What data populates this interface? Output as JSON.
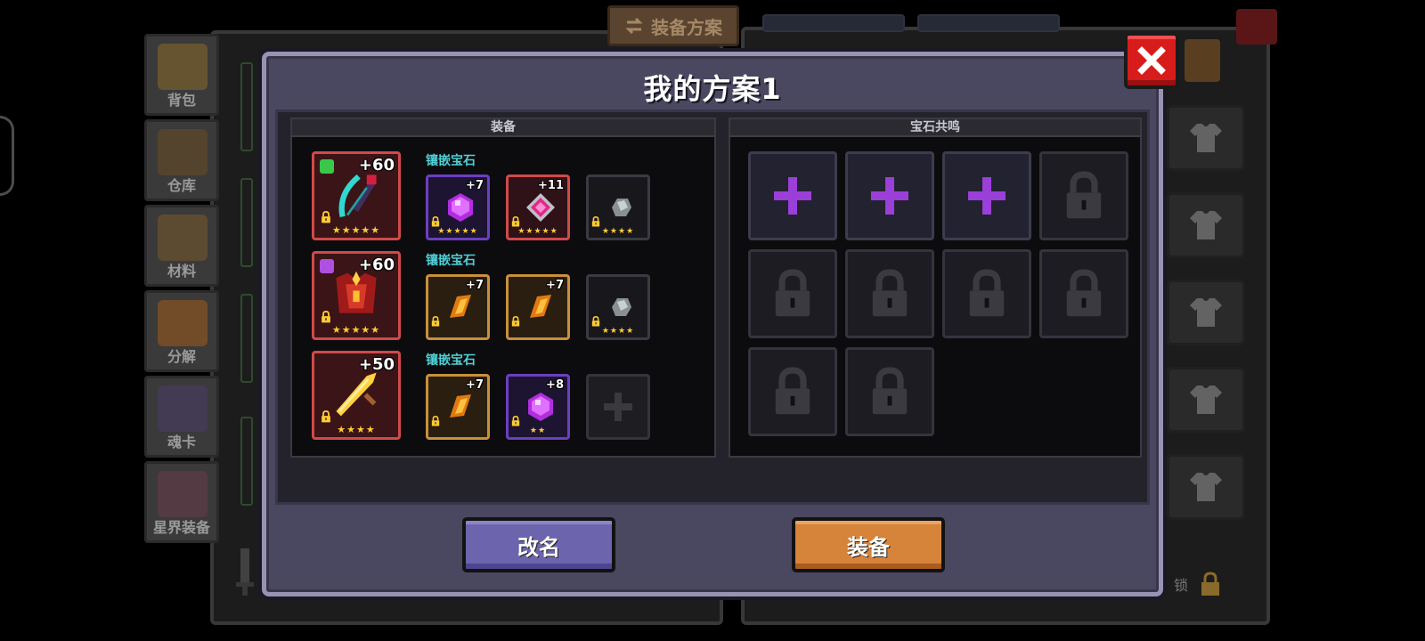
{
  "background": {
    "nav_items": [
      {
        "label": "背包",
        "icon": "backpack-icon",
        "color": "#8a6a2a"
      },
      {
        "label": "仓库",
        "icon": "warehouse-chest-icon",
        "color": "#6a4a22"
      },
      {
        "label": "材料",
        "icon": "materials-book-icon",
        "color": "#7a5a2a"
      },
      {
        "label": "分解",
        "icon": "decompose-furnace-icon",
        "color": "#a05a1a"
      },
      {
        "label": "魂卡",
        "icon": "soul-card-icon",
        "color": "#4a3a6a"
      },
      {
        "label": "星界装备",
        "icon": "astral-gear-icon",
        "color": "#6a3a4a"
      }
    ],
    "plan_tab_label": "装备方案",
    "lock_text": "锁"
  },
  "modal": {
    "title": "我的方案1",
    "equipment_header": "装备",
    "resonance_header": "宝石共鸣",
    "inlay_label": "镶嵌宝石",
    "equipment": [
      {
        "name": "weapon-bow",
        "level": "+60",
        "stars": "★★★★★",
        "frame": "#d04a4a",
        "badge": "green-gem",
        "sockets": [
          {
            "type": "purple",
            "gem": "amethyst",
            "level": "+7",
            "stars": "★★★★★"
          },
          {
            "type": "red",
            "gem": "ruby-crest",
            "level": "+11",
            "stars": "★★★★★"
          },
          {
            "type": "grey",
            "gem": "stone",
            "level": "",
            "stars": "★★★★"
          }
        ]
      },
      {
        "name": "armor-crimson",
        "level": "+60",
        "stars": "★★★★★",
        "frame": "#d04a4a",
        "badge": "purple-sparkle",
        "sockets": [
          {
            "type": "gold",
            "gem": "amber",
            "level": "+7",
            "stars": ""
          },
          {
            "type": "gold",
            "gem": "amber",
            "level": "+7",
            "stars": ""
          },
          {
            "type": "grey",
            "gem": "stone",
            "level": "",
            "stars": "★★★★"
          }
        ]
      },
      {
        "name": "sword-golden",
        "level": "+50",
        "stars": "★★★★",
        "frame": "#d04a4a",
        "badge": "",
        "sockets": [
          {
            "type": "gold",
            "gem": "amber",
            "level": "+7",
            "stars": ""
          },
          {
            "type": "purple",
            "gem": "amethyst",
            "level": "+8",
            "stars": "★★"
          },
          {
            "type": "empty",
            "gem": "",
            "level": "",
            "stars": ""
          }
        ]
      }
    ],
    "resonance_slots": [
      "add",
      "add",
      "add",
      "locked",
      "locked",
      "locked",
      "locked",
      "locked",
      "locked",
      "locked"
    ],
    "rename_button": "改名",
    "equip_button": "装备",
    "colors": {
      "add_plus": "#9a3fd8",
      "lock": "#3a3a40",
      "accent_cyan": "#4fd0d6",
      "close_red": "#d81c1c"
    }
  }
}
